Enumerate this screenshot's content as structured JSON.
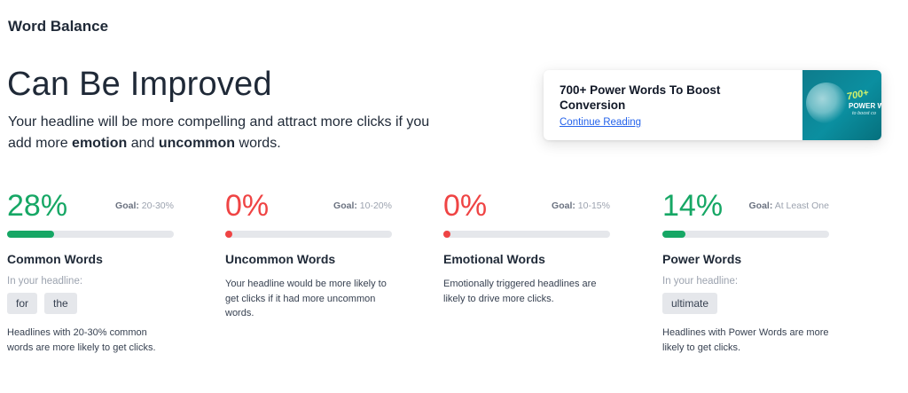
{
  "section": {
    "title": "Word Balance"
  },
  "verdict": {
    "heading": "Can Be Improved",
    "desc_before": "Your headline will be more compelling and attract more clicks if you add more ",
    "desc_em1": "emotion",
    "desc_mid": " and ",
    "desc_em2": "uncommon",
    "desc_after": " words."
  },
  "promo": {
    "title": "700+ Power Words To Boost Conversion",
    "link": "Continue Reading",
    "thumb_number": "700+",
    "thumb_word": "POWER W",
    "thumb_sub": "to boost co"
  },
  "colors": {
    "good": "#16a765",
    "bad": "#ef4444",
    "track": "#e5e7eb",
    "link": "#2563eb"
  },
  "metrics": [
    {
      "percent": "28%",
      "progress": 0.28,
      "status": "good",
      "goal_label": "Goal:",
      "goal_value": "20-30%",
      "name": "Common Words",
      "sub_label": "In your headline:",
      "chips": [
        "for",
        "the"
      ],
      "note": "Headlines with 20-30% common words are more likely to get clicks."
    },
    {
      "percent": "0%",
      "progress": 0,
      "status": "bad",
      "goal_label": "Goal:",
      "goal_value": "10-20%",
      "name": "Uncommon Words",
      "note": "Your headline would be more likely to get clicks if it had more uncommon words."
    },
    {
      "percent": "0%",
      "progress": 0,
      "status": "bad",
      "goal_label": "Goal:",
      "goal_value": "10-15%",
      "name": "Emotional Words",
      "note": "Emotionally triggered headlines are likely to drive more clicks."
    },
    {
      "percent": "14%",
      "progress": 0.14,
      "status": "good",
      "goal_label": "Goal:",
      "goal_value": "At Least One",
      "name": "Power Words",
      "sub_label": "In your headline:",
      "chips": [
        "ultimate"
      ],
      "note": "Headlines with Power Words are more likely to get clicks."
    }
  ]
}
